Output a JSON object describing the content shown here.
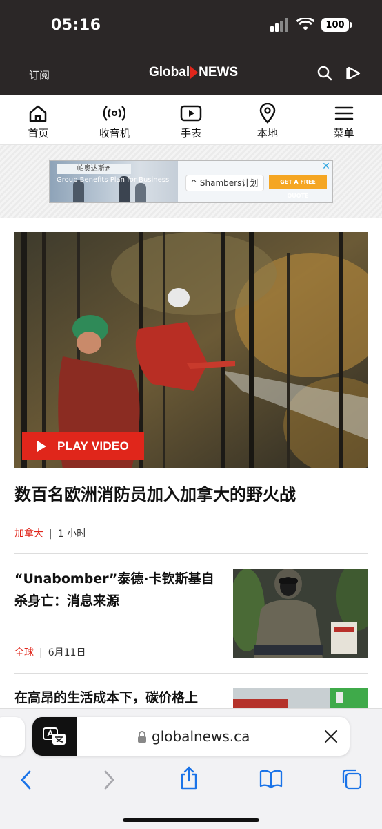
{
  "status": {
    "time": "05:16",
    "battery": "100"
  },
  "header": {
    "subscribe": "订阅",
    "logo_left": "Global",
    "logo_right": "NEWS"
  },
  "nav": {
    "home": "首页",
    "radio": "收音机",
    "watch": "手表",
    "local": "本地",
    "menu": "菜单"
  },
  "ad": {
    "tag": "帕奥达斯#",
    "headline": "Group Benefits Plan for Business",
    "brand": "^ Shambers计划",
    "cta": "GET A FREE QUOTE"
  },
  "hero": {
    "play_label": "PLAY VIDEO",
    "title": "数百名欧洲消防员加入加拿大的野火战",
    "category": "加拿大",
    "time": "1  小时"
  },
  "stories": [
    {
      "title": "“Unabomber”泰德·卡钦斯基自杀身亡：消息来源",
      "category": "全球",
      "date": "6月11日"
    },
    {
      "title": "在高昂的生活成本下，碳价格上"
    }
  ],
  "browser": {
    "url": "globalnews.ca"
  },
  "colors": {
    "accent": "#e0261b",
    "header_bg": "#2b2727",
    "link_blue": "#1a73e8"
  },
  "icons": [
    "signal-icon",
    "wifi-icon",
    "battery-icon",
    "search-icon",
    "play-icon",
    "home-icon",
    "radio-icon",
    "video-icon",
    "location-pin-icon",
    "menu-icon",
    "translate-icon",
    "lock-icon",
    "close-icon",
    "back-icon",
    "forward-icon",
    "share-icon",
    "bookmarks-icon",
    "tabs-icon"
  ]
}
